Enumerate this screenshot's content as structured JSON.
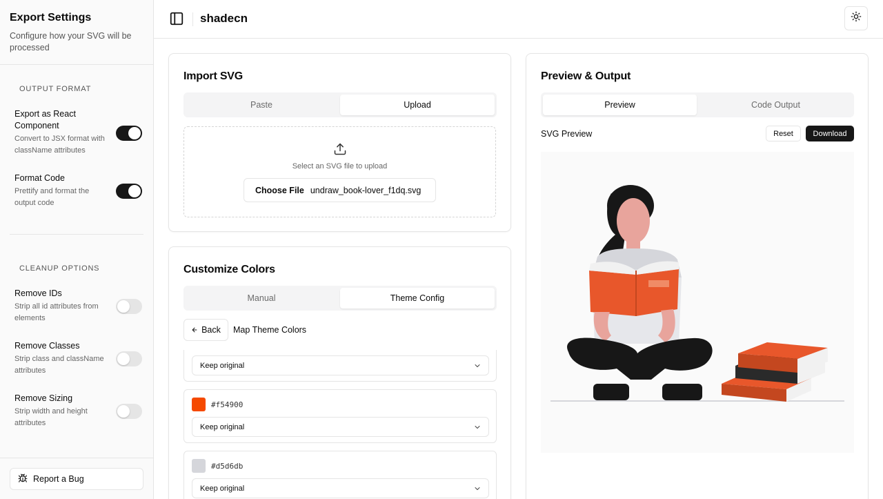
{
  "sidebar": {
    "title": "Export Settings",
    "subtitle": "Configure how your SVG will be processed",
    "output_format": {
      "label": "OUTPUT FORMAT",
      "items": [
        {
          "title": "Export as React Component",
          "desc": "Convert to JSX format with className attributes",
          "enabled": true
        },
        {
          "title": "Format Code",
          "desc": "Prettify and format the output code",
          "enabled": true
        }
      ]
    },
    "cleanup": {
      "label": "CLEANUP OPTIONS",
      "items": [
        {
          "title": "Remove IDs",
          "desc": "Strip all id attributes from elements",
          "enabled": false
        },
        {
          "title": "Remove Classes",
          "desc": "Strip class and className attributes",
          "enabled": false
        },
        {
          "title": "Remove Sizing",
          "desc": "Strip width and height attributes",
          "enabled": false
        }
      ]
    },
    "report_bug": "Report a Bug"
  },
  "header": {
    "title": "shadecn"
  },
  "import_card": {
    "title": "Import SVG",
    "tabs": [
      "Paste",
      "Upload"
    ],
    "active_tab": "Upload",
    "dropzone_text": "Select an SVG file to upload",
    "choose_file": "Choose File",
    "file_name": "undraw_book-lover_f1dq.svg"
  },
  "colors_card": {
    "title": "Customize Colors",
    "tabs": [
      "Manual",
      "Theme Config"
    ],
    "active_tab": "Theme Config",
    "back_label": "Back",
    "map_title": "Map Theme Colors",
    "items": [
      {
        "hex": "",
        "swatch": "",
        "select": "Keep original"
      },
      {
        "hex": "#f54900",
        "swatch": "#f54900",
        "select": "Keep original"
      },
      {
        "hex": "#d5d6db",
        "swatch": "#d5d6db",
        "select": "Keep original"
      }
    ]
  },
  "preview_card": {
    "title": "Preview & Output",
    "tabs": [
      "Preview",
      "Code Output"
    ],
    "active_tab": "Preview",
    "preview_label": "SVG Preview",
    "reset": "Reset",
    "download": "Download"
  },
  "colors": {
    "accent": "#e8572b",
    "dark": "#171717",
    "border": "#e5e5e5"
  }
}
